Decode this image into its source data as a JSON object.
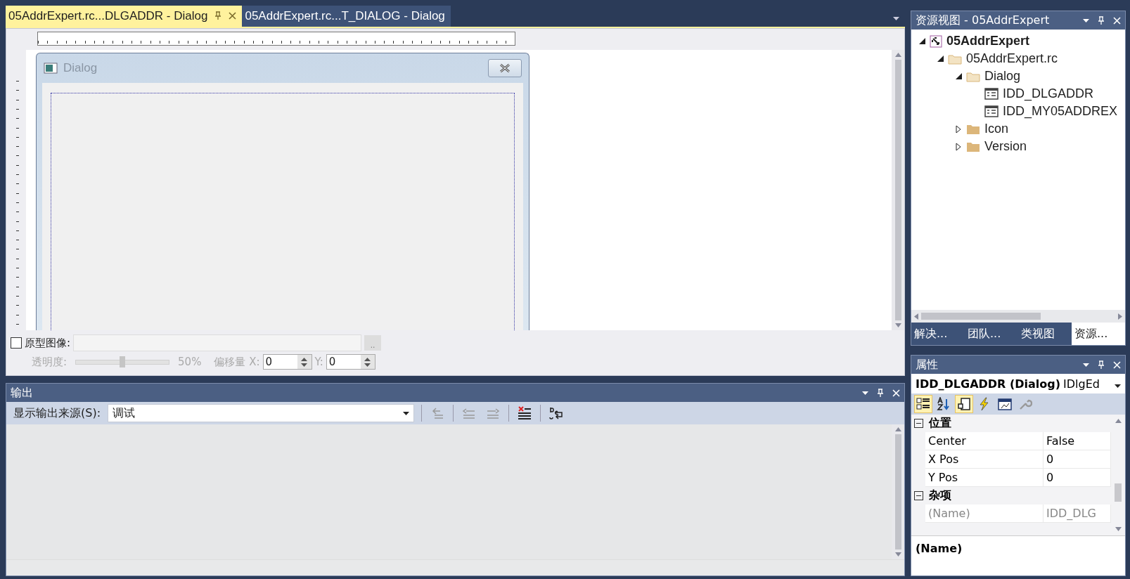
{
  "document_tabs": [
    {
      "label": "05AddrExpert.rc...DLGADDR - Dialog",
      "selected": true
    },
    {
      "label": "05AddrExpert.rc...T_DIALOG - Dialog",
      "selected": false
    }
  ],
  "dialog_editor": {
    "dialog_title": "Dialog",
    "prototype_image": {
      "label": "原型图像:",
      "checked": false,
      "browse": ".."
    },
    "opacity": {
      "label": "透明度:",
      "level": 0.5,
      "reading": "50%"
    },
    "offset_x": {
      "label": "偏移量 X:",
      "value": "0"
    },
    "offset_y": {
      "label": "Y:",
      "value": "0"
    }
  },
  "output": {
    "title": "输出",
    "source_label": "显示输出来源(S):",
    "source_value": "调试"
  },
  "resource_view": {
    "title": "资源视图 - 05AddrExpert",
    "tree": [
      {
        "label": "05AddrExpert",
        "kind": "project",
        "expanded": true,
        "children": [
          {
            "label": "05AddrExpert.rc",
            "kind": "folder",
            "expanded": true,
            "children": [
              {
                "label": "Dialog",
                "kind": "folder",
                "expanded": true,
                "children": [
                  {
                    "label": "IDD_DLGADDR",
                    "kind": "dialog"
                  },
                  {
                    "label": "IDD_MY05ADDREX",
                    "kind": "dialog"
                  }
                ]
              },
              {
                "label": "Icon",
                "kind": "folder",
                "expanded": false
              },
              {
                "label": "Version",
                "kind": "folder",
                "expanded": false
              }
            ]
          }
        ]
      }
    ]
  },
  "bottom_tabs": [
    {
      "label": "解决...",
      "selected": false
    },
    {
      "label": "团队...",
      "selected": false
    },
    {
      "label": "类视图",
      "selected": false
    },
    {
      "label": "资源...",
      "selected": true
    }
  ],
  "properties": {
    "title": "属性",
    "object": "IDD_DLGADDR (Dialog)",
    "object_type": "IDlgEd",
    "toolbar": [
      {
        "kind": "categorized",
        "selected": true
      },
      {
        "kind": "alphabetical",
        "selected": false
      },
      {
        "kind": "properties",
        "selected": true
      },
      {
        "kind": "events",
        "selected": false
      },
      {
        "kind": "messages",
        "selected": false
      },
      {
        "kind": "pages",
        "selected": false
      }
    ],
    "groups": [
      {
        "label": "位置",
        "expanded": true,
        "rows": [
          {
            "name": "Center",
            "value": "False",
            "disabled": false
          },
          {
            "name": "X Pos",
            "value": "0",
            "disabled": false
          },
          {
            "name": "Y Pos",
            "value": "0",
            "disabled": false
          }
        ]
      },
      {
        "label": "杂项",
        "expanded": true,
        "rows": [
          {
            "name": "(Name)",
            "value": "IDD_DLG",
            "disabled": true
          }
        ]
      }
    ],
    "description": "(Name)"
  }
}
